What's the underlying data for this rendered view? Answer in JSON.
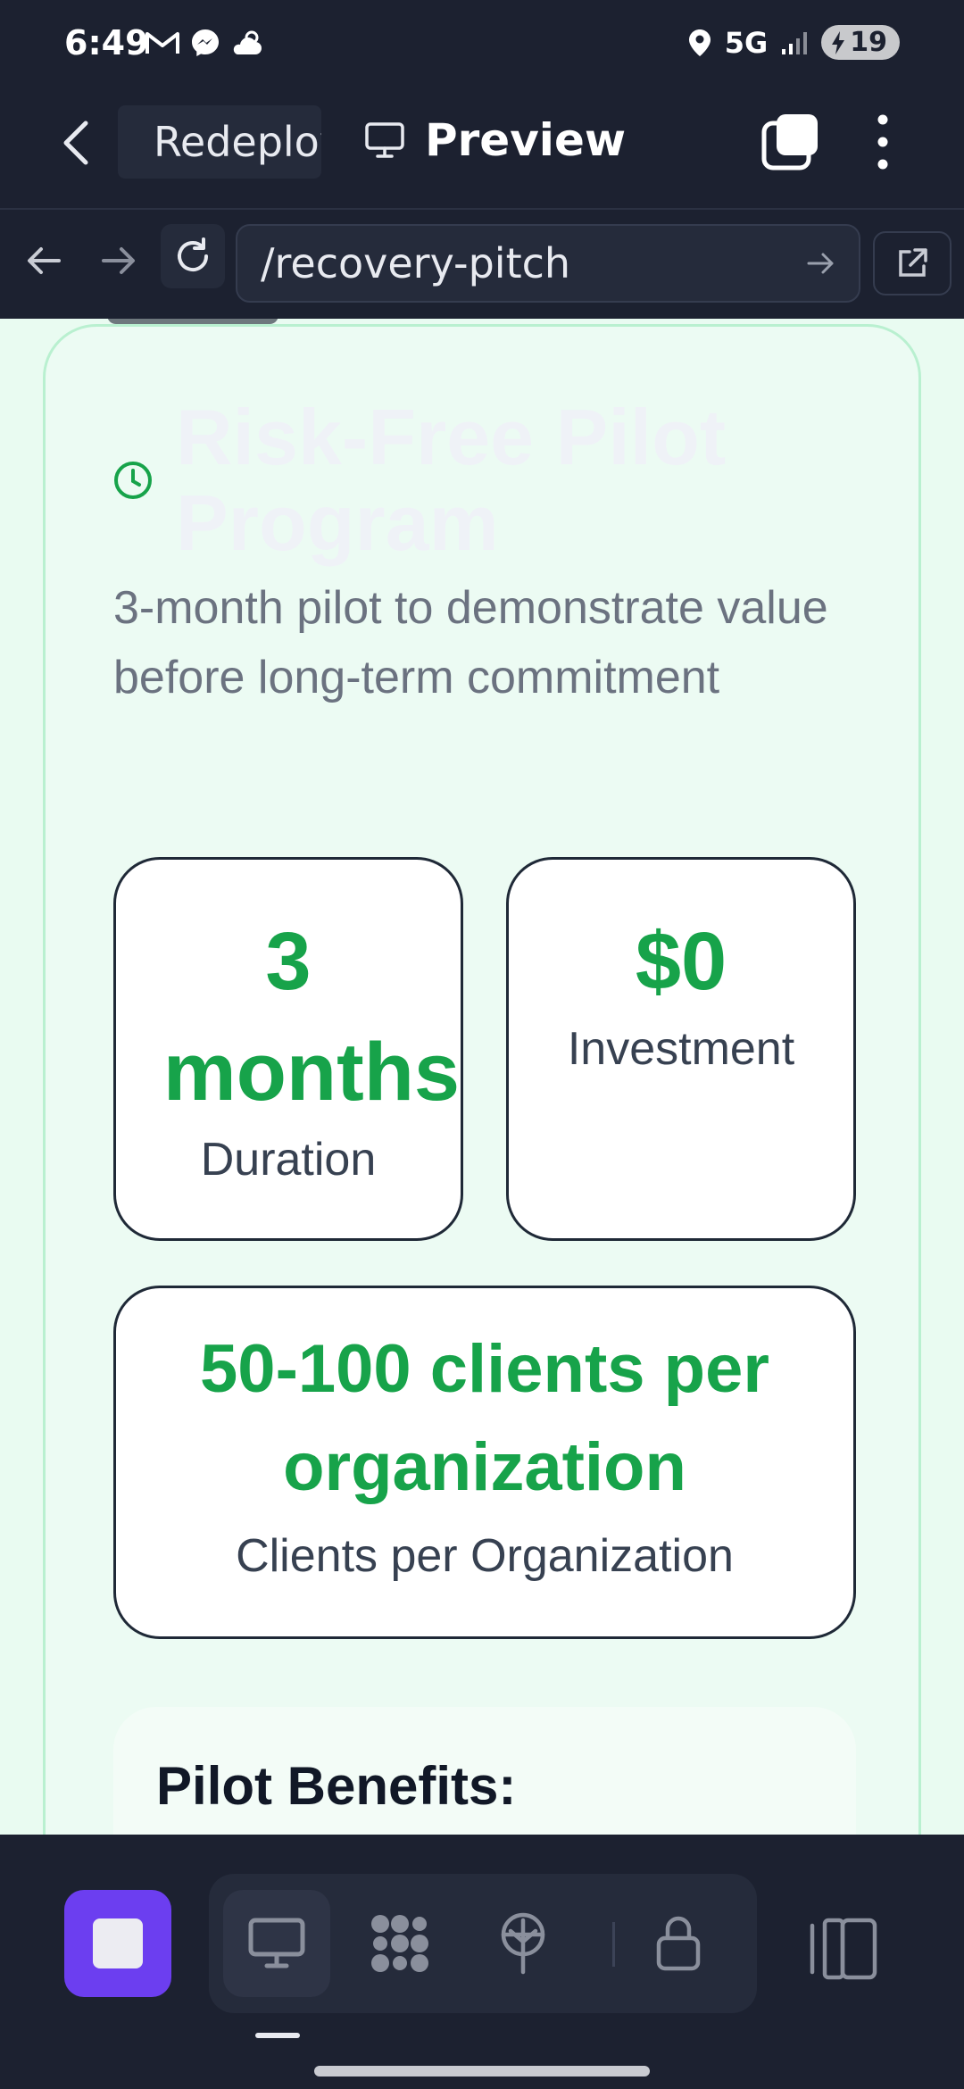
{
  "status_bar": {
    "time": "6:49",
    "network": "5G",
    "battery": "19",
    "icons": [
      "gmail-icon",
      "messenger-icon",
      "weather-icon",
      "location-icon",
      "signal-icon",
      "battery-charging-icon"
    ]
  },
  "toolbar": {
    "repl_tab_label": "Redeploy",
    "preview_label": "Preview"
  },
  "url_bar": {
    "url": "/recovery-pitch"
  },
  "card": {
    "title": "Risk-Free Pilot Program",
    "description": "3-month pilot to demonstrate value before long-term commitment",
    "stats": {
      "duration": {
        "value_line1": "3",
        "value_line2": "months",
        "label": "Duration"
      },
      "investment": {
        "value": "$0",
        "label": "Investment"
      },
      "clients": {
        "value": "50-100 clients per organization",
        "label": "Clients per Organization"
      }
    },
    "benefits_title": "Pilot Benefits:"
  },
  "colors": {
    "accent_green": "#17a34a",
    "stop_button": "#6c3ef0",
    "chrome_bg": "#1c2130"
  }
}
